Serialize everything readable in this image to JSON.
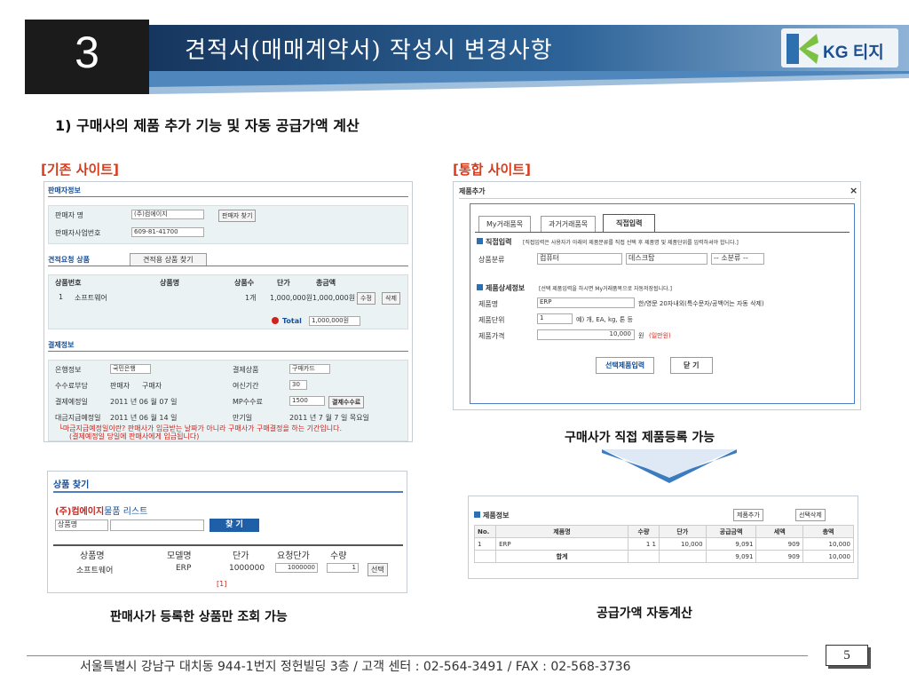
{
  "header": {
    "section_number": "3",
    "title": "견적서(매매계약서) 작성시 변경사항",
    "logo": "KG 티지"
  },
  "subtitle": "1) 구매사의 제품 추가 기능 및 자동 공급가액 계산",
  "legacy": {
    "label": "[기존 사이트]",
    "seller_section": "판매자정보",
    "seller_name_label": "판매자 명",
    "seller_name_value": "(주)컴에이지",
    "seller_search_button": "판매자 찾기",
    "biz_no_label": "판매자사업번호",
    "biz_no_value": "609-81-41700",
    "quote_section": "견적요청 상품",
    "quote_search_button": "견적용 상품 찾기",
    "quote_columns": [
      "상품번호",
      "상품명",
      "상품수",
      "단가",
      "총금액"
    ],
    "quote_row": {
      "no": "1",
      "name": "소프트웨어",
      "qty": "1개",
      "price": "1,000,000원",
      "total": "1,000,000원",
      "edit": "수정",
      "delete": "삭제"
    },
    "total_label": "Total",
    "total_value": "1,000,000원",
    "payment_section": "결제정보",
    "bank_label": "은행정보",
    "bank_value": "국민은행",
    "settle_product_label": "결제상품",
    "settle_product_value": "구매카드",
    "fee_label": "수수료부담",
    "fee_opt1": "판매자",
    "fee_opt2": "구매자",
    "credit_period_label": "여신기간",
    "credit_period_value": "30",
    "pay_date_label": "결제예정일",
    "pay_date_value": "2011 년 06 월 07 일",
    "mp_fee_label": "MP수수료",
    "mp_fee_value": "1500",
    "fee_button": "결제수수료",
    "mid_date_label": "대금지급예정일",
    "mid_date_value": "2011 년 06 월 14 일",
    "due_label": "만기일",
    "due_value": "2011 년 7 월 7 일 목요일",
    "notice1": "└마금지급예정일이란? 판매사가 입금받는 날짜가 아니라 구매사가 구매결정을 하는 기간입니다.",
    "notice2": "(결제예정일 당일에 판매사에게 입금됩니다)"
  },
  "product_search": {
    "title": "상품 찾기",
    "list_title": "(주)컴에이지",
    "list_suffix": "물품 리스트",
    "select_value": "상품명",
    "search_button": "찾 기",
    "columns": [
      "상품명",
      "모델명",
      "단가",
      "요청단가",
      "수량"
    ],
    "row": {
      "name": "소프트웨어",
      "model": "ERP",
      "price": "1000000",
      "req_price": "1000000",
      "qty": "1",
      "select": "선택"
    },
    "pagination": "[1]"
  },
  "integrated": {
    "label": "[통합 사이트]",
    "dialog_title": "제품추가",
    "close": "×",
    "tabs": [
      "My거래품목",
      "과거거래품목",
      "직접입력"
    ],
    "direct_title": "직접입력",
    "direct_desc": "[직접입력은 사용자가 아래의 제품분류를 직접 선택 후 제품명 및 제품단위를 입력하셔야 합니다.]",
    "category_label": "상품분류",
    "category1": "컴퓨터",
    "category2": "데스크탑",
    "category3": "-- 소분류 --",
    "detail_title": "제품상세정보",
    "detail_desc": "[선택 제품입력을 하시면 My거래품목으로 자동저장됩니다.]",
    "name_label": "제품명",
    "name_value": "ERP",
    "name_hint": "한/영문 20자내외(특수문자/공백어는 자동 삭제)",
    "unit_label": "제품단위",
    "unit_value": "1",
    "unit_hint": "예) 개, EA, kg, 톤 등",
    "price_label": "제품가격",
    "price_value": "10,000",
    "price_unit": "원",
    "price_note": "(일만원)",
    "submit_button": "선택제품입력",
    "close_button": "닫 기"
  },
  "product_info": {
    "title": "제품정보",
    "add_button": "제품추가",
    "delete_button": "선택삭제",
    "columns": [
      "No.",
      "제품명",
      "수량",
      "단가",
      "공급금액",
      "세액",
      "총액"
    ],
    "row": {
      "no": "1",
      "name": "ERP",
      "qty1": "1",
      "qty2": "1",
      "price": "10,000",
      "supply": "9,091",
      "tax": "909",
      "total": "10,000"
    },
    "sum_label": "합계",
    "sum_supply": "9,091",
    "sum_tax": "909",
    "sum_total": "10,000"
  },
  "captions": {
    "integrated": "구매사가 직접 제품등록 가능",
    "legacy": "판매사가 등록한 상품만 조회 가능",
    "auto": "공급가액 자동계산"
  },
  "footer": {
    "address": "서울특별시 강남구 대치동 944-1번지 정헌빌딩 3층  /  고객 센터 : 02-564-3491  /  FAX : 02-568-3736",
    "page": "5"
  }
}
